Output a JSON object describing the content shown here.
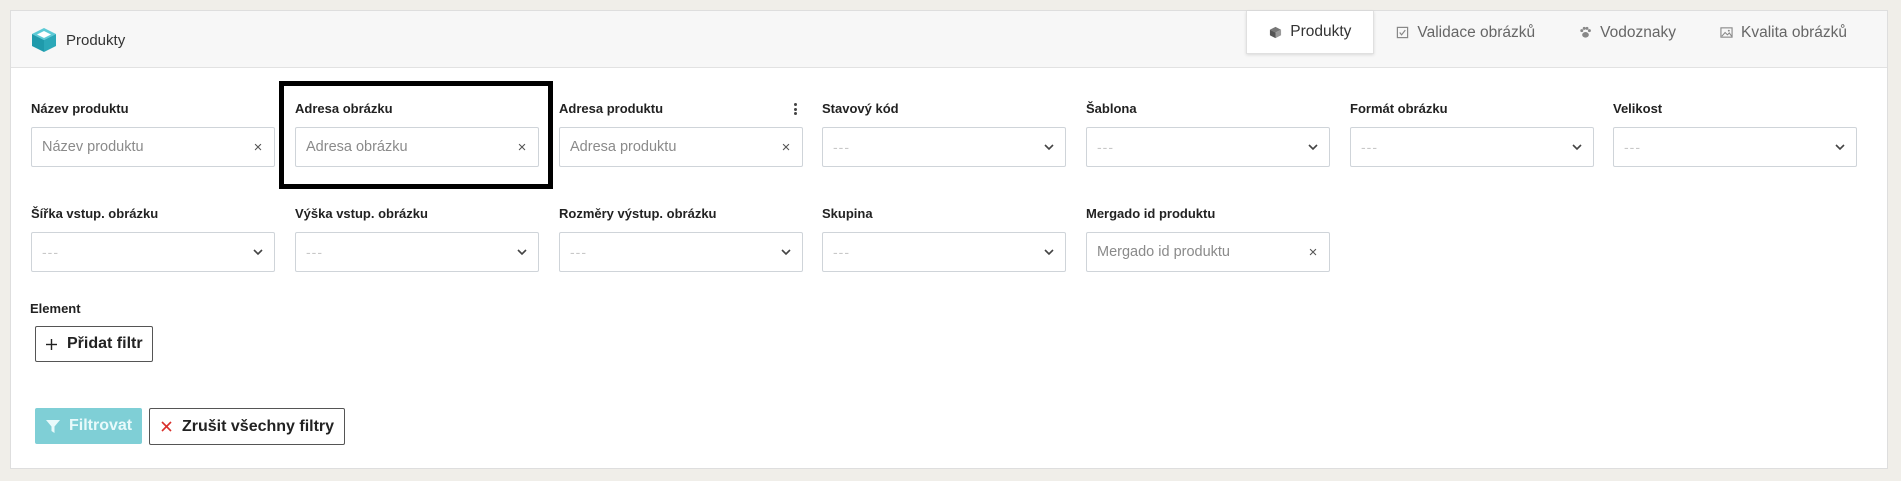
{
  "header": {
    "title": "Produkty",
    "tabs": [
      {
        "label": "Produkty",
        "icon": "box-icon",
        "active": true
      },
      {
        "label": "Validace obrázků",
        "icon": "image-check-icon",
        "active": false
      },
      {
        "label": "Vodoznaky",
        "icon": "paw-icon",
        "active": false
      },
      {
        "label": "Kvalita obrázků",
        "icon": "image-icon",
        "active": false
      }
    ]
  },
  "filters": {
    "nazev_produktu": {
      "label": "Název produktu",
      "placeholder": "Název produktu",
      "value": ""
    },
    "adresa_obrazku": {
      "label": "Adresa obrázku",
      "placeholder": "Adresa obrázku",
      "value": ""
    },
    "adresa_produktu": {
      "label": "Adresa produktu",
      "placeholder": "Adresa produktu",
      "value": ""
    },
    "stavovy_kod": {
      "label": "Stavový kód",
      "value": "---"
    },
    "sablona": {
      "label": "Šablona",
      "value": "---"
    },
    "format_obrazku": {
      "label": "Formát obrázku",
      "value": "---"
    },
    "velikost": {
      "label": "Velikost",
      "value": "---"
    },
    "sirka_vstup": {
      "label": "Šířka vstup. obrázku",
      "value": "---"
    },
    "vyska_vstup": {
      "label": "Výška vstup. obrázku",
      "value": "---"
    },
    "rozmery_vystup": {
      "label": "Rozměry výstup. obrázku",
      "value": "---"
    },
    "skupina": {
      "label": "Skupina",
      "value": "---"
    },
    "mergado_id": {
      "label": "Mergado id produktu",
      "placeholder": "Mergado id produktu",
      "value": ""
    }
  },
  "element": {
    "label": "Element",
    "add_filter_label": "Přidat filtr"
  },
  "actions": {
    "filter_label": "Filtrovat",
    "clear_label": "Zrušit všechny filtry"
  },
  "colors": {
    "brand_teal": "#2ba8b8",
    "filter_button_bg": "#7fcfd6",
    "clear_x": "#d9302b"
  }
}
